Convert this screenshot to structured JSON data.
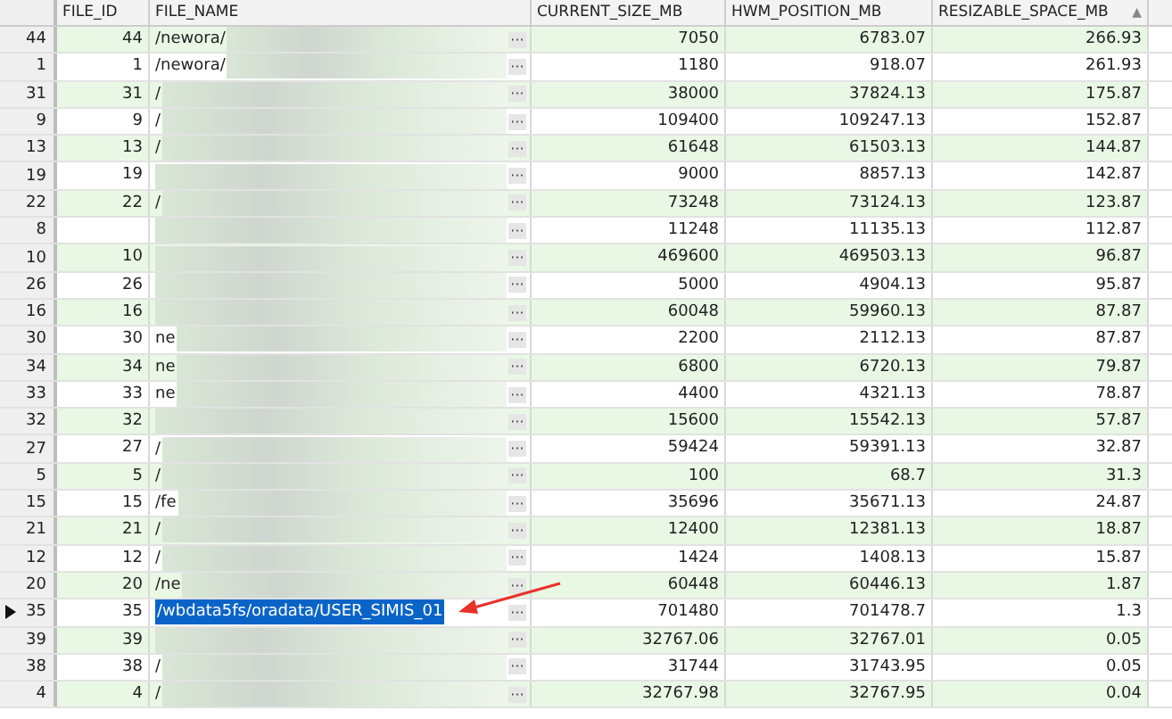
{
  "columns": [
    "FILE_ID",
    "FILE_NAME",
    "CURRENT_SIZE_MB",
    "HWM_POSITION_MB",
    "RESIZABLE_SPACE_MB"
  ],
  "sort_indicator": "▲",
  "rows": [
    {
      "row_number": "44",
      "file_id": "44",
      "file_name": "/newora/",
      "redacted": true,
      "current_size_mb": "7050",
      "hwm_position_mb": "6783.07",
      "resizable_space_mb": "266.93",
      "selected": false
    },
    {
      "row_number": "1",
      "file_id": "1",
      "file_name": "/newora/",
      "redacted": true,
      "current_size_mb": "1180",
      "hwm_position_mb": "918.07",
      "resizable_space_mb": "261.93",
      "selected": false
    },
    {
      "row_number": "31",
      "file_id": "31",
      "file_name": "/",
      "redacted": true,
      "current_size_mb": "38000",
      "hwm_position_mb": "37824.13",
      "resizable_space_mb": "175.87",
      "selected": false
    },
    {
      "row_number": "9",
      "file_id": "9",
      "file_name": "/",
      "redacted": true,
      "current_size_mb": "109400",
      "hwm_position_mb": "109247.13",
      "resizable_space_mb": "152.87",
      "selected": false
    },
    {
      "row_number": "13",
      "file_id": "13",
      "file_name": "/",
      "redacted": true,
      "current_size_mb": "61648",
      "hwm_position_mb": "61503.13",
      "resizable_space_mb": "144.87",
      "selected": false
    },
    {
      "row_number": "19",
      "file_id": "19",
      "redacted": true,
      "current_size_mb": "9000",
      "hwm_position_mb": "8857.13",
      "resizable_space_mb": "142.87",
      "selected": false
    },
    {
      "row_number": "22",
      "file_id": "22",
      "file_name": "/",
      "redacted": true,
      "current_size_mb": "73248",
      "hwm_position_mb": "73124.13",
      "resizable_space_mb": "123.87",
      "selected": false
    },
    {
      "row_number": "8",
      "redacted": true,
      "current_size_mb": "11248",
      "hwm_position_mb": "11135.13",
      "resizable_space_mb": "112.87",
      "selected": false
    },
    {
      "row_number": "10",
      "file_id": "10",
      "redacted": true,
      "current_size_mb": "469600",
      "hwm_position_mb": "469503.13",
      "resizable_space_mb": "96.87",
      "selected": false
    },
    {
      "row_number": "26",
      "file_id": "26",
      "redacted": true,
      "current_size_mb": "5000",
      "hwm_position_mb": "4904.13",
      "resizable_space_mb": "95.87",
      "selected": false
    },
    {
      "row_number": "16",
      "file_id": "16",
      "redacted": true,
      "current_size_mb": "60048",
      "hwm_position_mb": "59960.13",
      "resizable_space_mb": "87.87",
      "selected": false
    },
    {
      "row_number": "30",
      "file_id": "30",
      "file_name": "ne",
      "redacted": true,
      "current_size_mb": "2200",
      "hwm_position_mb": "2112.13",
      "resizable_space_mb": "87.87",
      "selected": false
    },
    {
      "row_number": "34",
      "file_id": "34",
      "file_name": "ne",
      "redacted": true,
      "current_size_mb": "6800",
      "hwm_position_mb": "6720.13",
      "resizable_space_mb": "79.87",
      "selected": false
    },
    {
      "row_number": "33",
      "file_id": "33",
      "file_name": "ne",
      "redacted": true,
      "current_size_mb": "4400",
      "hwm_position_mb": "4321.13",
      "resizable_space_mb": "78.87",
      "selected": false
    },
    {
      "row_number": "32",
      "file_id": "32",
      "redacted": true,
      "current_size_mb": "15600",
      "hwm_position_mb": "15542.13",
      "resizable_space_mb": "57.87",
      "selected": false
    },
    {
      "row_number": "27",
      "file_id": "27",
      "file_name": "/",
      "redacted": true,
      "current_size_mb": "59424",
      "hwm_position_mb": "59391.13",
      "resizable_space_mb": "32.87",
      "selected": false
    },
    {
      "row_number": "5",
      "file_id": "5",
      "file_name": "/",
      "redacted": true,
      "current_size_mb": "100",
      "hwm_position_mb": "68.7",
      "resizable_space_mb": "31.3",
      "selected": false
    },
    {
      "row_number": "15",
      "file_id": "15",
      "file_name": "/fe",
      "redacted": true,
      "current_size_mb": "35696",
      "hwm_position_mb": "35671.13",
      "resizable_space_mb": "24.87",
      "selected": false
    },
    {
      "row_number": "21",
      "file_id": "21",
      "file_name": "/",
      "redacted": true,
      "current_size_mb": "12400",
      "hwm_position_mb": "12381.13",
      "resizable_space_mb": "18.87",
      "selected": false
    },
    {
      "row_number": "12",
      "file_id": "12",
      "file_name": "/",
      "redacted": true,
      "current_size_mb": "1424",
      "hwm_position_mb": "1408.13",
      "resizable_space_mb": "15.87",
      "selected": false
    },
    {
      "row_number": "20",
      "file_id": "20",
      "file_name": "/ne",
      "redacted": true,
      "current_size_mb": "60448",
      "hwm_position_mb": "60446.13",
      "resizable_space_mb": "1.87",
      "selected": false
    },
    {
      "row_number": "35",
      "file_id": "35",
      "file_name": "/wbdata5fs/oradata/USER_SIMIS_01",
      "redacted": false,
      "current_size_mb": "701480",
      "hwm_position_mb": "701478.7",
      "resizable_space_mb": "1.3",
      "selected": true
    },
    {
      "row_number": "39",
      "file_id": "39",
      "redacted": true,
      "current_size_mb": "32767.06",
      "hwm_position_mb": "32767.01",
      "resizable_space_mb": "0.05",
      "selected": false
    },
    {
      "row_number": "38",
      "file_id": "38",
      "file_name": "/",
      "redacted": true,
      "current_size_mb": "31744",
      "hwm_position_mb": "31743.95",
      "resizable_space_mb": "0.05",
      "selected": false
    },
    {
      "row_number": "4",
      "file_id": "4",
      "file_name": "/",
      "redacted": true,
      "current_size_mb": "32767.98",
      "hwm_position_mb": "32767.95",
      "resizable_space_mb": "0.04",
      "selected": false
    }
  ],
  "ellipsis_button": "···"
}
